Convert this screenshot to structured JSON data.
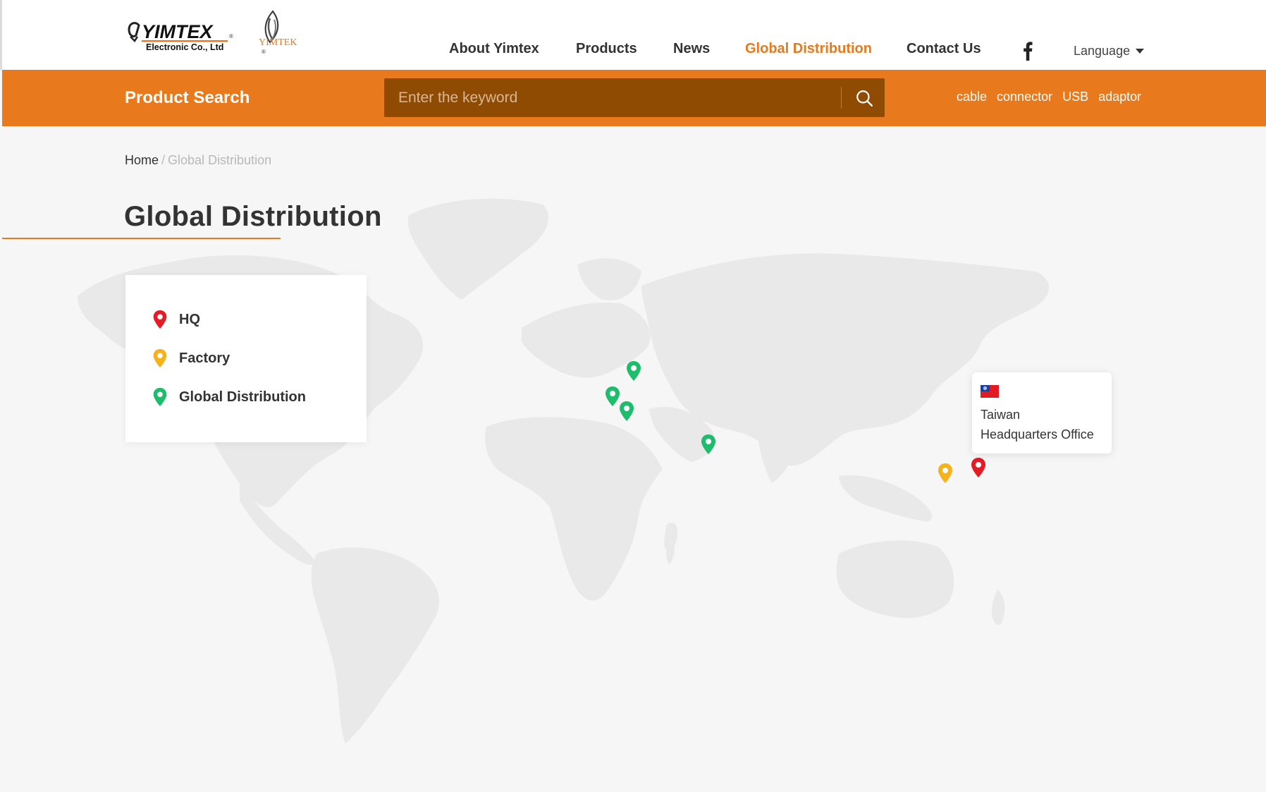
{
  "header": {
    "logo": {
      "brand": "YIMTEX",
      "subtitle": "Electronic Co., Ltd",
      "mark": "YIMTEK"
    },
    "nav": [
      {
        "label": "About Yimtex",
        "active": false
      },
      {
        "label": "Products",
        "active": false
      },
      {
        "label": "News",
        "active": false
      },
      {
        "label": "Global Distribution",
        "active": true
      },
      {
        "label": "Contact Us",
        "active": false
      }
    ],
    "social_icon": "facebook-icon",
    "language_label": "Language"
  },
  "search": {
    "title": "Product Search",
    "placeholder": "Enter the keyword",
    "button_icon": "search-icon",
    "tags": [
      "cable",
      "connector",
      "USB",
      "adaptor"
    ]
  },
  "breadcrumb": {
    "home": "Home",
    "separator": "/",
    "current": "Global Distribution"
  },
  "page_title": "Global Distribution",
  "legend": [
    {
      "label": "HQ",
      "color": "#e31c25"
    },
    {
      "label": "Factory",
      "color": "#f5b21a"
    },
    {
      "label": "Global Distribution",
      "color": "#1dbd6c"
    }
  ],
  "tooltip": {
    "flag_icon": "taiwan-flag-icon",
    "line1": "Taiwan",
    "line2": "Headquarters Office"
  },
  "colors": {
    "accent": "#e8791d",
    "search_box": "#8f4b02",
    "map_land": "#e9e9e9",
    "background": "#f6f6f6"
  }
}
